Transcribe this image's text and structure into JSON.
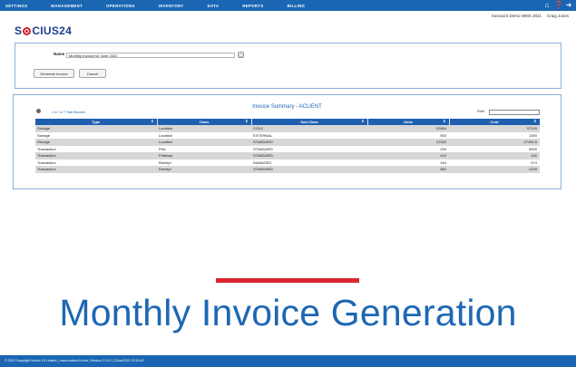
{
  "nav": {
    "items": [
      "SETTINGS",
      "MANAGEMENT",
      "OPERATIONS",
      "INVENTORY",
      "DATA",
      "REPORTS",
      "BILLING"
    ],
    "icons": [
      "home-icon",
      "help-icon",
      "logout-icon"
    ]
  },
  "user": {
    "instance": "Socius24 Demo WMS 2021",
    "name": "Craig Jones"
  },
  "brand": {
    "logo_left": "S",
    "logo_right": "CIUS24",
    "primary_color": "#1a66b3",
    "accent_color": "#d9262f"
  },
  "form": {
    "name_label": "Name",
    "name_value": "Monthly Invoice for June 2022",
    "generate_label": "Generate Invoice",
    "cancel_label": "Cancel"
  },
  "invoice": {
    "title": "Invoice Summary - ACLIENT",
    "records": "1 to 7 of 7 Total Records",
    "filter_label": "Filter",
    "columns": [
      "Type",
      "Class",
      "Sub-Class",
      "Units",
      "Cost"
    ],
    "rows": [
      [
        "Storage",
        "Location",
        "COLD",
        "22664",
        "97149"
      ],
      [
        "Storage",
        "Location",
        "EXTERNAL",
        "500",
        "1000"
      ],
      [
        "Storage",
        "Location",
        "STANDARD",
        "21532",
        "47490.5"
      ],
      [
        "Transaction",
        "Pick",
        "STANDARD",
        "200",
        "5000"
      ],
      [
        "Transaction",
        "Putaway",
        "STANDARD",
        "442",
        "442"
      ],
      [
        "Transaction",
        "Receipt",
        "DAMAGED",
        "164",
        "574"
      ],
      [
        "Transaction",
        "Receipt",
        "STANDARD",
        "852",
        "2209"
      ]
    ]
  },
  "banner": {
    "title": "Monthly Invoice Generation"
  },
  "footer": {
    "text": "© 2022 Copyright Socius 24 Limited.   |   www.socius24.com   |   Version 2.10.0   |   2/Jun/2022 10:30:43"
  }
}
